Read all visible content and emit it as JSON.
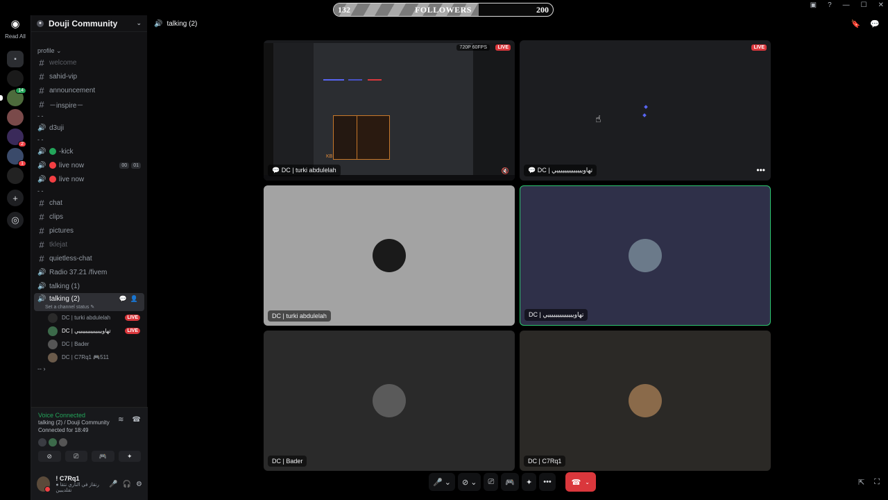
{
  "rail": {
    "read_all": "Read All",
    "servers": [
      {
        "name": "folder",
        "color": "#2b2d31"
      },
      {
        "name": "server-dagger",
        "color": "#1a1a1a"
      },
      {
        "name": "server-green-helmet",
        "color": "#4d6b3c",
        "badge": "14"
      },
      {
        "name": "server-anime",
        "color": "#7a4a4a"
      },
      {
        "name": "server-multi",
        "color": "#3a2a5a",
        "badge": "2"
      },
      {
        "name": "server-flower",
        "color": "#3a4a6a",
        "badge": "1"
      },
      {
        "name": "server-fighters",
        "color": "#222"
      }
    ]
  },
  "guild": {
    "name": "Douji Community"
  },
  "sidebar": {
    "categories": {
      "profile": "profile ⌄",
      "c1": "- -",
      "c2": "- -",
      "c3": "- -",
      "c4": "-- ›"
    },
    "channels_text_1": [
      {
        "label": "welcome",
        "muted": true
      },
      {
        "label": "sahid-vip"
      },
      {
        "label": "announcement"
      },
      {
        "label": "－inspire－"
      }
    ],
    "channels_voice_1": [
      {
        "label": "d3uji"
      }
    ],
    "channels_voice_2": [
      {
        "label": "-kick",
        "dot": "#23a55a"
      },
      {
        "label": "live now",
        "dot": "#f23f43",
        "tags": [
          "00",
          "01"
        ]
      },
      {
        "label": "live now",
        "dot": "#f23f43"
      }
    ],
    "channels_text_2": [
      {
        "label": "chat",
        "type": "text"
      },
      {
        "label": "clips",
        "type": "text"
      },
      {
        "label": "pictures",
        "type": "text"
      },
      {
        "label": "tklejat",
        "type": "text",
        "muted": true
      },
      {
        "label": "quietless-chat",
        "type": "text"
      },
      {
        "label": "Radio 37.21 /fivem",
        "type": "voice"
      },
      {
        "label": "talking (1)",
        "type": "voice"
      }
    ],
    "active_channel": {
      "label": "talking (2)",
      "status": "Set a channel status ✎"
    },
    "voice_users": [
      {
        "name": "DC | turki abdulelah",
        "live": "LIVE"
      },
      {
        "name": "DC | ﺗﻬﺎﻭﻳﻴﻴﻴﻴﻴﻴﻴﻴﻴﻴﻴﻴﻴﻲ",
        "live": "LIVE"
      },
      {
        "name": "DC | Bader"
      },
      {
        "name": "DC | C7Rq1 🎮511"
      }
    ]
  },
  "voice_panel": {
    "title": "Voice Connected",
    "channel": "talking (2) / Douji Community",
    "time": "Connected for 18:49"
  },
  "user": {
    "name": "! C7Rq1",
    "status": "● ﺭﻧﻘﺎﺯ ﻓﻲ ﺍﻟﻨﺎﺭﻱ ﻧﺘﻘﺎ ﺗﻘﻠﺪﻳﺒﻴﻦ"
  },
  "topbar": {
    "channel": "talking (2)"
  },
  "followers": {
    "current": "132",
    "label": "FOLLOWERS",
    "goal": "200",
    "progress": 0.66
  },
  "tiles": [
    {
      "label": "DC | turki abdulelah",
      "live": "LIVE",
      "quality": "720P 60FPS"
    },
    {
      "label": "DC | ﺗﻬﺎﻭﻳﻴﻴﻴﻴﻴﻴﻴﻴﻴﻴﻴﻴﻴﻲ",
      "live": "LIVE"
    },
    {
      "label": "DC | turki abdulelah",
      "avatar": "#1a1a1a"
    },
    {
      "label": "DC | ﺗﻬﺎﻭﻳﻴﻴﻴﻴﻴﻴﻴﻴﻴﻴﻴﻴﻴﻲ",
      "avatar": "#6b7a8a"
    },
    {
      "label": "DC | Bader",
      "avatar": "#5a5a5a"
    },
    {
      "label": "DC | C7Rq1",
      "avatar": "#8a6a4a"
    }
  ],
  "screen_card_text": "KB"
}
